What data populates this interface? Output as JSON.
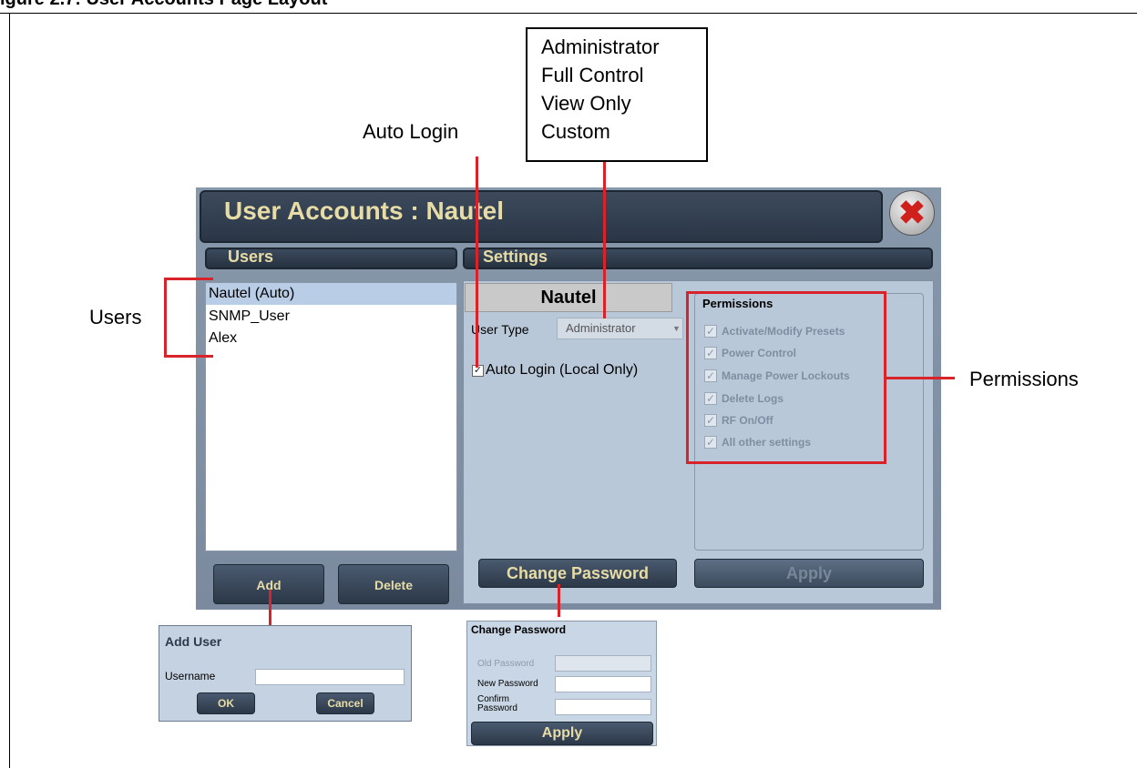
{
  "figure": {
    "title": "igure 2.7: User Accounts Page Layout"
  },
  "callouts": {
    "auto_login": "Auto Login",
    "users": "Users",
    "permissions": "Permissions"
  },
  "user_type_options": [
    "Administrator",
    "Full Control",
    "View Only",
    "Custom"
  ],
  "window": {
    "title": "User Accounts : Nautel",
    "users_header": "Users",
    "settings_header": "Settings"
  },
  "users": [
    "Nautel (Auto)",
    "SNMP_User",
    "Alex"
  ],
  "settings": {
    "selected_name": "Nautel",
    "user_type_label": "User Type",
    "user_type_value": "Administrator",
    "auto_login_label": "Auto Login (Local Only)",
    "auto_login_checked": true,
    "permissions_title": "Permissions",
    "permissions": [
      "Activate/Modify Presets",
      "Power Control",
      "Manage Power Lockouts",
      "Delete Logs",
      "RF On/Off",
      "All other settings"
    ],
    "change_password_label": "Change Password",
    "apply_label": "Apply"
  },
  "users_buttons": {
    "add": "Add",
    "delete": "Delete"
  },
  "add_user_dialog": {
    "title": "Add User",
    "username_label": "Username",
    "username_value": "",
    "ok": "OK",
    "cancel": "Cancel"
  },
  "change_password_dialog": {
    "title": "Change Password",
    "old_password_label": "Old Password",
    "new_password_label": "New Password",
    "confirm_password_label": "Confirm Password",
    "apply": "Apply"
  },
  "colors": {
    "callout_red": "#d8232a",
    "window_bg": "#7b8a9e",
    "header_text": "#e7dca6"
  }
}
